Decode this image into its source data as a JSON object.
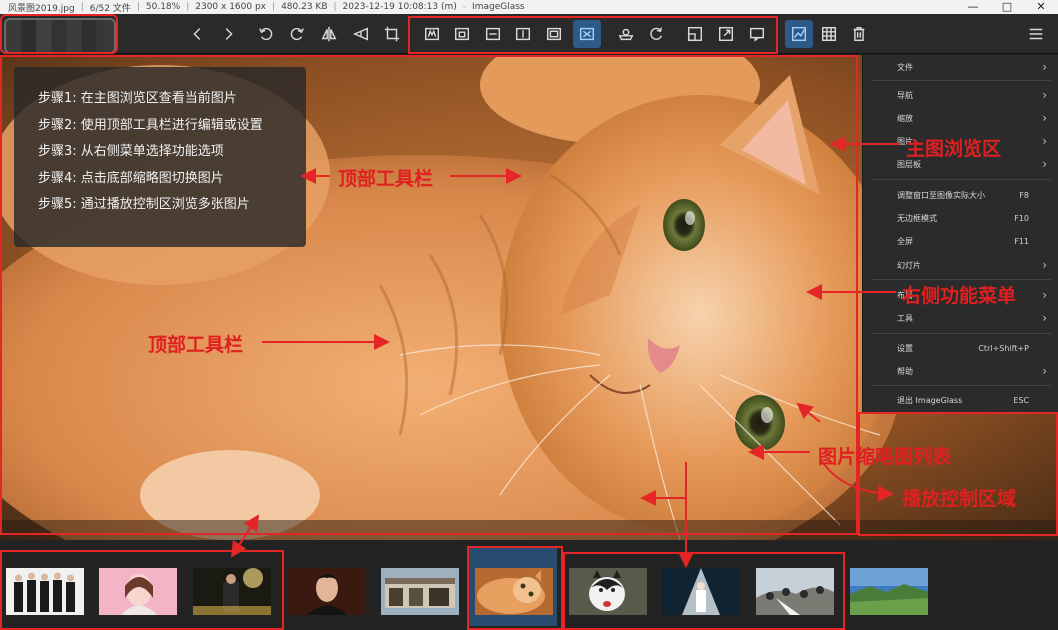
{
  "titlebar": {
    "filename": "风景图2019.jpg",
    "index": "6/52 文件",
    "zoom": "50.18%",
    "dimensions": "2300 x 1600 px",
    "filesize": "480.23 KB",
    "datetime": "2023-12-19 10:08:13 (m)",
    "app_name": "ImageGlass"
  },
  "steps": [
    "步骤1: 在主图浏览区查看当前图片",
    "步骤2: 使用顶部工具栏进行编辑或设置",
    "步骤3: 从右侧菜单选择功能选项",
    "步骤4: 点击底部缩略图切换图片",
    "步骤5: 通过播放控制区浏览多张图片"
  ],
  "menu": [
    {
      "label": "文件",
      "shortcut": "",
      "submenu": true
    },
    {
      "label": "导航",
      "shortcut": "",
      "submenu": true
    },
    {
      "label": "缩放",
      "shortcut": "",
      "submenu": true
    },
    {
      "label": "图片",
      "shortcut": "",
      "submenu": true
    },
    {
      "label": "图层板",
      "shortcut": "",
      "submenu": true
    },
    {
      "label": "调整窗口至图像实际大小",
      "shortcut": "F8",
      "submenu": false
    },
    {
      "label": "无边框模式",
      "shortcut": "F10",
      "submenu": false
    },
    {
      "label": "全屏",
      "shortcut": "F11",
      "submenu": false
    },
    {
      "label": "幻灯片",
      "shortcut": "",
      "submenu": true
    },
    {
      "label": "布局",
      "shortcut": "",
      "submenu": true
    },
    {
      "label": "工具",
      "shortcut": "",
      "submenu": true
    },
    {
      "label": "设置",
      "shortcut": "Ctrl+Shift+P",
      "submenu": false
    },
    {
      "label": "帮助",
      "shortcut": "",
      "submenu": true
    },
    {
      "label": "退出 ImageGlass",
      "shortcut": "ESC",
      "submenu": false
    }
  ],
  "annotations": {
    "main_view": "主图浏览区",
    "top_toolbar_1": "顶部工具栏",
    "top_toolbar_2": "顶部工具栏",
    "right_menu": "右侧功能菜单",
    "thumbnail_list": "图片缩略图列表",
    "playback_area": "播放控制区域"
  },
  "toolbar_icons": [
    "back-icon",
    "forward-icon",
    "rotate-left-icon",
    "rotate-right-icon",
    "flip-horizontal-icon",
    "flip-vertical-icon",
    "crop-icon",
    "auto-zoom-icon",
    "lock-zoom-icon",
    "scale-width-icon",
    "scale-height-icon",
    "scale-to-fit-icon",
    "scale-to-fill-icon",
    "slideshow-icon",
    "refresh-icon",
    "fit-window-icon",
    "actual-size-icon",
    "gallery-icon",
    "color-picker-icon",
    "checkerboard-icon",
    "delete-icon",
    "menu-icon"
  ],
  "colors": {
    "accent": "#2d5a86",
    "annotation_red": "#e52626",
    "toolbar_bg": "#2a2a2a",
    "menu_bg": "#2b2b2b"
  },
  "thumbnails": [
    "group-photo",
    "pink-portrait",
    "concert",
    "portrait-man",
    "street-shop",
    "orange-cat",
    "husky-dog",
    "stage",
    "crowd",
    "landscape"
  ],
  "selected_thumbnail": "orange-cat"
}
